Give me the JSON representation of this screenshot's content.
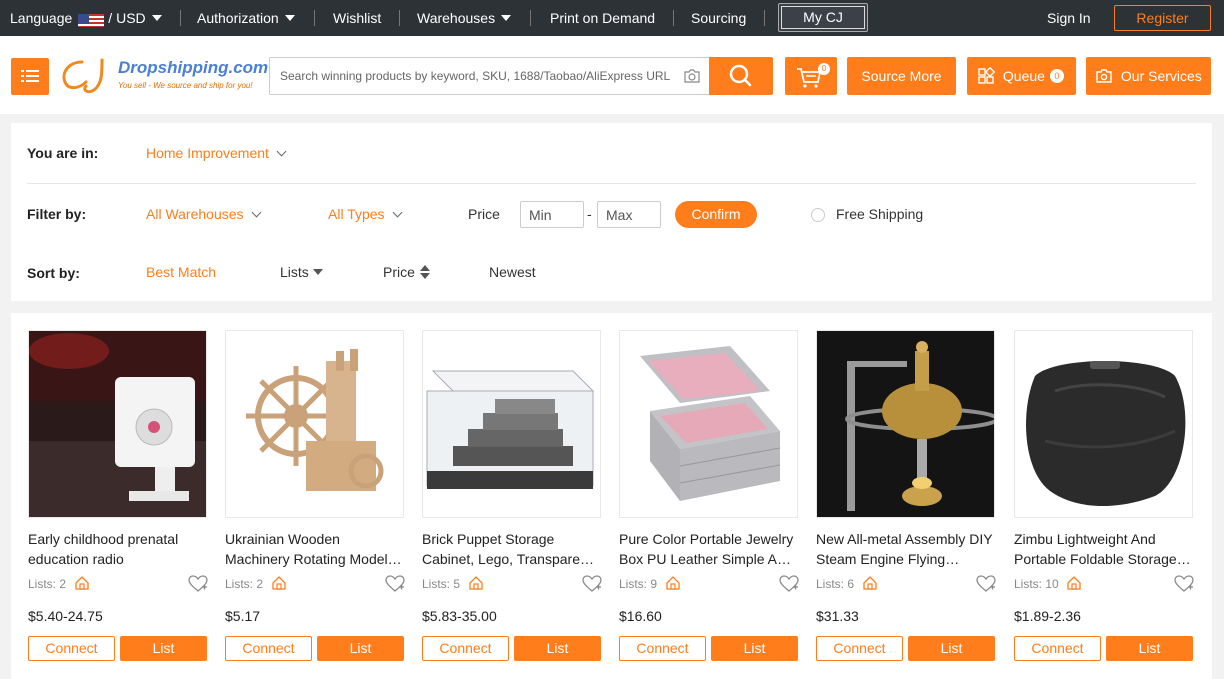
{
  "topbar": {
    "language": "Language",
    "currency": "USD",
    "separator": "/",
    "authorization": "Authorization",
    "wishlist": "Wishlist",
    "warehouses": "Warehouses",
    "print_on_demand": "Print on Demand",
    "sourcing": "Sourcing",
    "my_cj": "My CJ",
    "sign_in": "Sign In",
    "register": "Register"
  },
  "header": {
    "logo_text": "Dropshipping.com",
    "logo_tagline": "You sell - We source and ship for you!",
    "search_placeholder": "Search winning products by keyword, SKU, 1688/Taobao/AliExpress URL",
    "cart_count": "0",
    "source_more": "Source More",
    "queue": "Queue",
    "queue_count": "0",
    "our_services": "Our Services"
  },
  "filters": {
    "you_are_in_label": "You are in:",
    "category": "Home Improvement",
    "filter_by_label": "Filter by:",
    "warehouses": "All Warehouses",
    "types": "All Types",
    "price_label": "Price",
    "min_placeholder": "Min",
    "max_placeholder": "Max",
    "dash": "-",
    "confirm": "Confirm",
    "free_shipping": "Free Shipping",
    "sort_by_label": "Sort by:",
    "sort_best_match": "Best Match",
    "sort_lists": "Lists",
    "sort_price": "Price",
    "sort_newest": "Newest"
  },
  "products": [
    {
      "title": "Early childhood prenatal education radio",
      "lists": "Lists: 2",
      "price": "$5.40-24.75",
      "connect": "Connect",
      "list": "List"
    },
    {
      "title": "Ukrainian Wooden Machinery Rotating Model…",
      "lists": "Lists: 2",
      "price": "$5.17",
      "connect": "Connect",
      "list": "List"
    },
    {
      "title": "Brick Puppet Storage Cabinet, Lego, Transpare…",
      "lists": "Lists: 5",
      "price": "$5.83-35.00",
      "connect": "Connect",
      "list": "List"
    },
    {
      "title": "Pure Color Portable Jewelry Box PU Leather Simple A…",
      "lists": "Lists: 9",
      "price": "$16.60",
      "connect": "Connect",
      "list": "List"
    },
    {
      "title": "New All-metal Assembly DIY Steam Engine Flying Sauc…",
      "lists": "Lists: 6",
      "price": "$31.33",
      "connect": "Connect",
      "list": "List"
    },
    {
      "title": "Zimbu Lightweight And Portable Foldable Storage…",
      "lists": "Lists: 10",
      "price": "$1.89-2.36",
      "connect": "Connect",
      "list": "List"
    }
  ],
  "icons": {
    "menu": "menu-icon",
    "camera": "camera-icon",
    "search": "search-icon",
    "cart": "cart-icon",
    "queue": "queue-icon",
    "services": "services-icon",
    "home": "home-icon",
    "heart": "heart-icon",
    "flag": "us-flag-icon"
  },
  "colors": {
    "accent": "#ff7d1a",
    "topbar": "#2d3237",
    "logo_blue": "#4a7fd6"
  }
}
